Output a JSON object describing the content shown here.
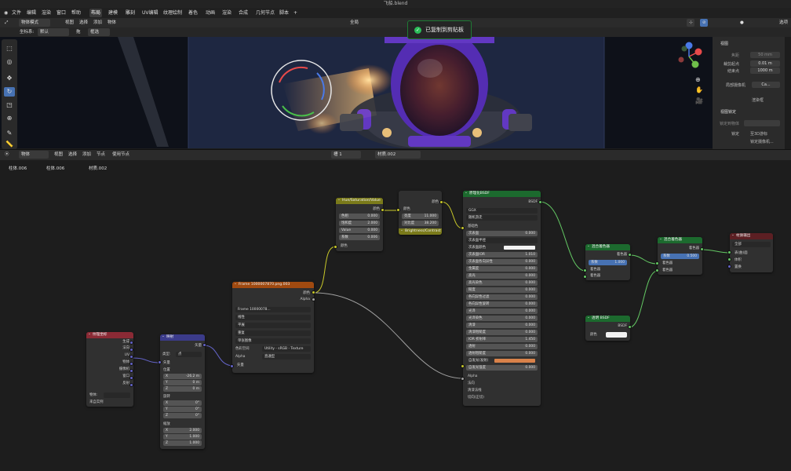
{
  "window": {
    "title": "飞船.blend"
  },
  "menu": {
    "items": [
      "文件",
      "编辑",
      "渲染",
      "窗口",
      "帮助"
    ],
    "workspaces": [
      "布局",
      "建模",
      "雕刻",
      "UV编辑",
      "纹理绘制",
      "着色",
      "动画",
      "渲染",
      "合成",
      "几何节点",
      "脚本"
    ],
    "add": "+"
  },
  "viewport_header": {
    "mode": "物体模式",
    "view": "视图",
    "select": "选择",
    "add": "添加",
    "object": "物体",
    "orientation_label": "坐标系:",
    "orientation": "默认",
    "drag_label": "拖",
    "select_mode": "框选",
    "global": "全局",
    "options": "选项"
  },
  "toast": {
    "text": "已复制到剪贴板"
  },
  "npanel": {
    "section_view": "视图",
    "focal_label": "焦距",
    "focal_value": "50 mm",
    "clip_start_label": "裁剪起点",
    "clip_start": "0.01 m",
    "clip_end_label": "结束点",
    "clip_end": "1000 m",
    "local_camera_label": "局部摄像机",
    "local_camera": "Ca...",
    "render_region": "渲染框",
    "section_lock": "视图锁定",
    "lock_to_object": "锁定到物体",
    "lock_label": "锁定",
    "lock_3d_cursor": "至3D游标",
    "lock_camera": "锁定摄像机..."
  },
  "node_header": {
    "object": "物体",
    "view": "视图",
    "select": "选择",
    "add": "添加",
    "node": "节点",
    "use_nodes": "使用节点",
    "slot": "槽 1",
    "material": "材质.002"
  },
  "breadcrumb": [
    "柱体.006",
    "柱体.006",
    "材质.002"
  ],
  "nodes": {
    "texcoord": {
      "title": "纹理坐标",
      "outputs": [
        "生成",
        "法向",
        "UV",
        "物体",
        "摄像机",
        "窗口",
        "反射"
      ],
      "object_label": "物体:",
      "from_instancer": "来自实例"
    },
    "mapping": {
      "title": "映射",
      "out": "矢量",
      "type_label": "类型:",
      "type_value": "点",
      "vector": "矢量",
      "location": "位置",
      "loc": [
        "-26.2 m",
        "0 m",
        "0 m"
      ],
      "rotation": "旋转",
      "rot": [
        "0°",
        "0°",
        "0°"
      ],
      "scale": "缩放",
      "scl": [
        "2.000",
        "1.000",
        "1.000"
      ],
      "axes": [
        "X",
        "Y",
        "Z"
      ]
    },
    "image": {
      "title": "Frame 1000007870.png.003",
      "out_color": "颜色",
      "out_alpha": "Alpha",
      "image_name": "Frame 10000078...",
      "interp": "线性",
      "proj": "平展",
      "ext": "重复",
      "source": "单张图像",
      "colorspace_label": "色彩空间",
      "colorspace": "Utility - sRGB - Texture",
      "alpha_label": "Alpha",
      "alpha": "直通型",
      "in_vector": "矢量"
    },
    "hsv": {
      "title": "Hue/Saturation/Value",
      "out": "颜色",
      "fields": [
        [
          "色相",
          "0.000"
        ],
        [
          "饱和度",
          "2.000"
        ],
        [
          "Value",
          "0.000"
        ],
        [
          "系数",
          "0.006"
        ]
      ],
      "in": "颜色"
    },
    "bc": {
      "title": "Brightness/Contrast",
      "out": "颜色",
      "in": "颜色",
      "fields": [
        [
          "亮度",
          "11.000"
        ],
        [
          "对比度",
          "38.200"
        ]
      ]
    },
    "bsdf": {
      "title": "原理化BSDF",
      "out": "BSDF",
      "dist": "GGX",
      "sss": "随机游走",
      "base": "基础色",
      "rows": [
        [
          "次表面",
          "0.000"
        ],
        [
          "次表面半径",
          ""
        ],
        [
          "次表面颜色",
          ""
        ],
        [
          "次表面IOR",
          "1.010"
        ],
        [
          "次表面各向异性",
          "0.000"
        ],
        [
          "金属度",
          "0.000"
        ],
        [
          "高光",
          "0.000"
        ],
        [
          "高光染色",
          "0.000"
        ],
        [
          "糙度",
          "0.000"
        ],
        [
          "各向异性过滤",
          "0.000"
        ],
        [
          "各向异性旋转",
          "0.000"
        ],
        [
          "光泽",
          "0.000"
        ],
        [
          "光泽染色",
          "0.000"
        ],
        [
          "清漆",
          "0.000"
        ],
        [
          "清漆粗糙度",
          "0.000"
        ],
        [
          "IOR 折射率",
          "1.450"
        ],
        [
          "透射",
          "0.000"
        ],
        [
          "透射粗糙度",
          "0.000"
        ]
      ],
      "emission": "自发光(发射)",
      "emission_strength": [
        "自发光强度",
        "0.000"
      ],
      "alpha": "Alpha",
      "normal": "法向",
      "clearcoat_normal": "清漆法线",
      "tangent": "切向(正切)"
    },
    "mix1": {
      "title": "混合着色器",
      "out": "着色器",
      "fac_label": "系数",
      "fac": "1.000",
      "in1": "着色器",
      "in2": "着色器"
    },
    "mix2": {
      "title": "混合着色器",
      "out": "着色器",
      "fac_label": "系数",
      "fac": "0.500",
      "in1": "着色器",
      "in2": "着色器"
    },
    "transparent": {
      "title": "透明 BSDF",
      "out": "BSDF",
      "in": "颜色"
    },
    "output": {
      "title": "材质输出",
      "target": "全部",
      "inputs": [
        "表(曲)面",
        "体积",
        "置换"
      ]
    }
  },
  "colors": {
    "accent": "#4772b3",
    "toast_border": "#1e7a34",
    "shader_header": "#1c6a2e",
    "input_header": "#8a2a35",
    "vector_header": "#3b3b8a",
    "color_header": "#7a7a1a",
    "texture_header": "#a04a10",
    "output_header": "#5c1f23"
  }
}
